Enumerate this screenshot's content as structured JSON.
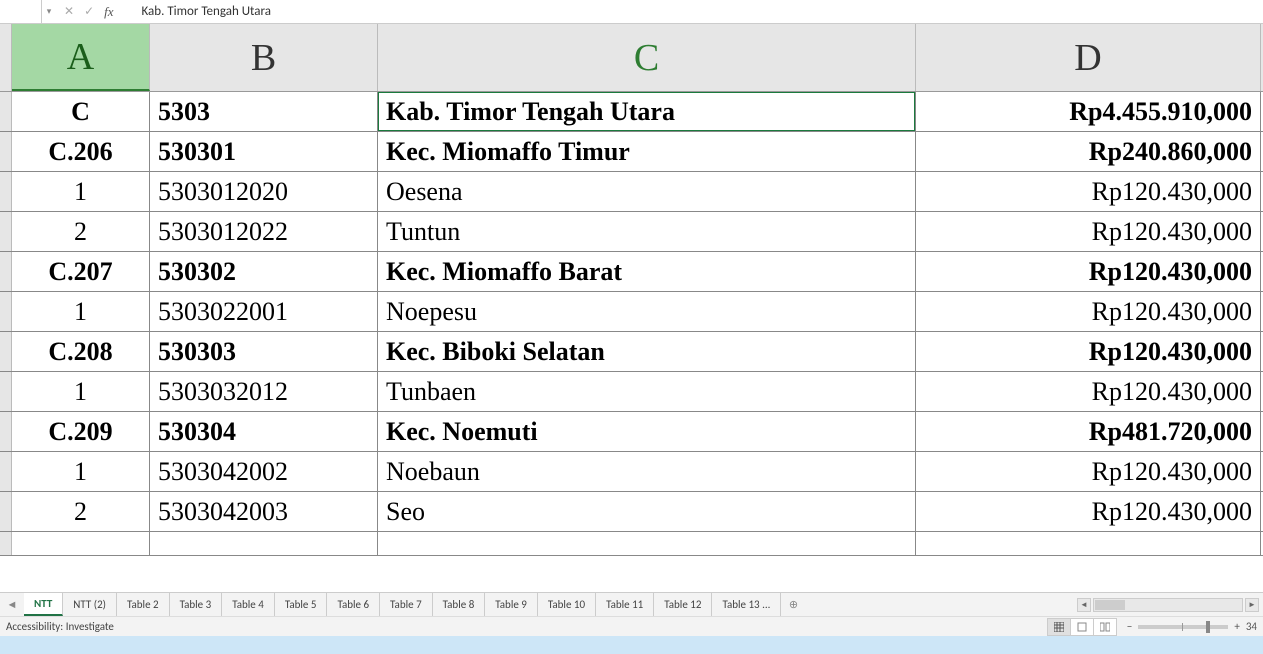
{
  "formula_bar": {
    "name_box": "",
    "cancel": "✕",
    "enter": "✓",
    "fx": "fx",
    "content": "Kab. Timor Tengah Utara"
  },
  "columns": [
    "A",
    "B",
    "C",
    "D"
  ],
  "active_cell": "C1",
  "selected_col": "A",
  "rows": [
    {
      "a": "C",
      "b": "5303",
      "c": "Kab. Timor Tengah Utara",
      "d": "Rp4.455.910,000",
      "bold": true,
      "a_align": "center"
    },
    {
      "a": "C.206",
      "b": "530301",
      "c": "Kec. Miomaffo Timur",
      "d": "Rp240.860,000",
      "bold": true,
      "a_align": "center"
    },
    {
      "a": "1",
      "b": "5303012020",
      "c": "Oesena",
      "d": "Rp120.430,000",
      "bold": false,
      "a_align": "center"
    },
    {
      "a": "2",
      "b": "5303012022",
      "c": "Tuntun",
      "d": "Rp120.430,000",
      "bold": false,
      "a_align": "center"
    },
    {
      "a": "C.207",
      "b": "530302",
      "c": "Kec. Miomaffo Barat",
      "d": "Rp120.430,000",
      "bold": true,
      "a_align": "center"
    },
    {
      "a": "1",
      "b": "5303022001",
      "c": "Noepesu",
      "d": "Rp120.430,000",
      "bold": false,
      "a_align": "center"
    },
    {
      "a": "C.208",
      "b": "530303",
      "c": "Kec. Biboki Selatan",
      "d": "Rp120.430,000",
      "bold": true,
      "a_align": "center"
    },
    {
      "a": "1",
      "b": "5303032012",
      "c": "Tunbaen",
      "d": "Rp120.430,000",
      "bold": false,
      "a_align": "center"
    },
    {
      "a": "C.209",
      "b": "530304",
      "c": "Kec. Noemuti",
      "d": "Rp481.720,000",
      "bold": true,
      "a_align": "center"
    },
    {
      "a": "1",
      "b": "5303042002",
      "c": "Noebaun",
      "d": "Rp120.430,000",
      "bold": false,
      "a_align": "center"
    },
    {
      "a": "2",
      "b": "5303042003",
      "c": "Seo",
      "d": "Rp120.430,000",
      "bold": false,
      "a_align": "center"
    }
  ],
  "partial_row": {
    "a": "",
    "b": "",
    "c": "",
    "d": ""
  },
  "tabs": [
    {
      "label": "NTT",
      "active": true
    },
    {
      "label": "NTT (2)",
      "active": false
    },
    {
      "label": "Table 2",
      "active": false
    },
    {
      "label": "Table 3",
      "active": false
    },
    {
      "label": "Table 4",
      "active": false
    },
    {
      "label": "Table 5",
      "active": false
    },
    {
      "label": "Table 6",
      "active": false
    },
    {
      "label": "Table 7",
      "active": false
    },
    {
      "label": "Table 8",
      "active": false
    },
    {
      "label": "Table 9",
      "active": false
    },
    {
      "label": "Table 10",
      "active": false
    },
    {
      "label": "Table 11",
      "active": false
    },
    {
      "label": "Table 12",
      "active": false
    },
    {
      "label": "Table 13 ...",
      "active": false
    }
  ],
  "status": {
    "accessibility": "Accessibility: Investigate",
    "zoom_minus": "−",
    "zoom_plus": "+",
    "zoom_value": "34"
  }
}
